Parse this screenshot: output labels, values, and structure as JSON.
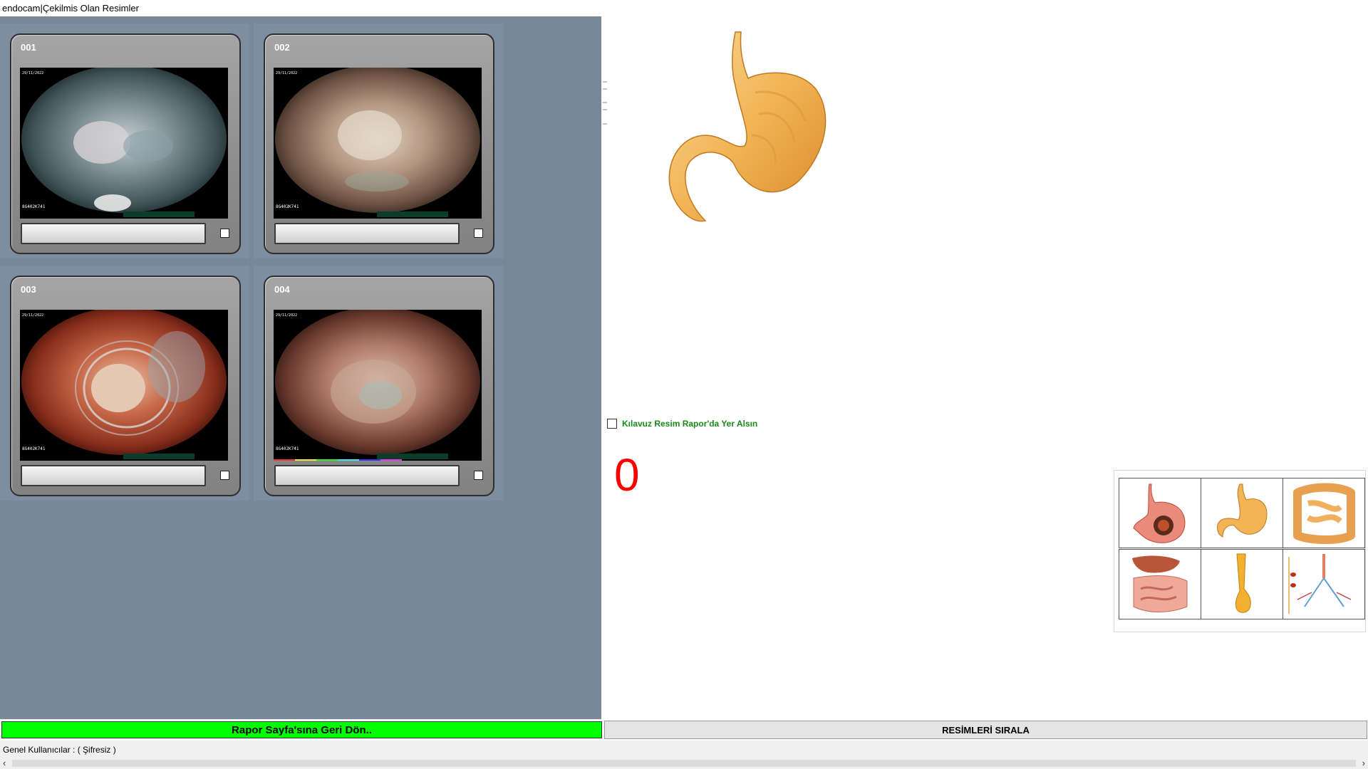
{
  "window": {
    "title": "endocam|Çekilmis Olan Resimler"
  },
  "gallery": {
    "cards": [
      {
        "number": "001",
        "checked": false
      },
      {
        "number": "002",
        "checked": false
      },
      {
        "number": "003",
        "checked": false
      },
      {
        "number": "004",
        "checked": false
      }
    ]
  },
  "guide_option": {
    "label": "Kılavuz Resim Rapor'da Yer Alsın",
    "checked": false
  },
  "counter": {
    "value": "0"
  },
  "organ_thumbnails": [
    {
      "name": "stomach-cross-section"
    },
    {
      "name": "stomach"
    },
    {
      "name": "colon"
    },
    {
      "name": "digestive-system"
    },
    {
      "name": "esophagus"
    },
    {
      "name": "bronchial-tree"
    }
  ],
  "buttons": {
    "back_label": "Rapor Sayfa'sına Geri Dön..",
    "sort_label": "RESİMLERİ SIRALA"
  },
  "status": {
    "text": "Genel Kullanıcılar : ( Şifresiz )"
  },
  "colors": {
    "panel": "#778899",
    "back_button": "#00ff00",
    "counter": "#ff0000",
    "guide_label": "#1a8a1a"
  }
}
